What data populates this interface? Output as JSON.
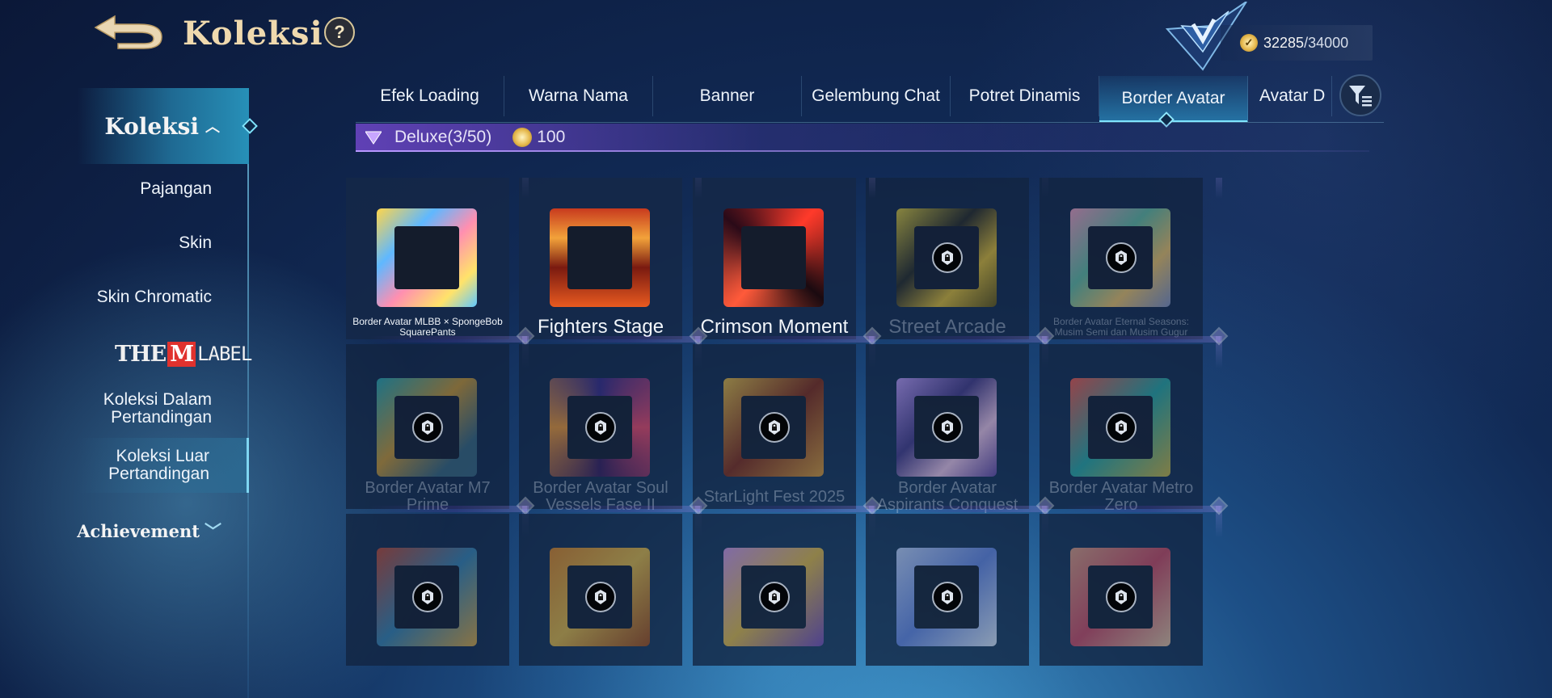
{
  "header": {
    "title": "Koleksi",
    "help_label": "?",
    "currency_current": "32285",
    "currency_max": "/34000"
  },
  "sidebar": {
    "koleksi_label": "Koleksi",
    "items": [
      "Pajangan",
      "Skin",
      "Skin Chromatic"
    ],
    "logo": {
      "the": "THE",
      "m": "M",
      "label": "LABEL"
    },
    "match_items": [
      {
        "line1": "Koleksi Dalam",
        "line2": "Pertandingan"
      },
      {
        "line1": "Koleksi Luar",
        "line2": "Pertandingan"
      }
    ],
    "achievement_label": "Achievement"
  },
  "tabs": [
    "Efek Loading",
    "Warna Nama",
    "Banner",
    "Gelembung Chat",
    "Potret Dinamis",
    "Border Avatar",
    "Avatar D"
  ],
  "active_tab": "Border Avatar",
  "deluxe": {
    "label": "Deluxe(3/50)",
    "price": "100"
  },
  "cards": [
    {
      "name": "Border Avatar MLBB × SpongeBob SquarePants",
      "locked": false
    },
    {
      "name": "Fighters Stage",
      "locked": false
    },
    {
      "name": "Crimson Moment",
      "locked": false
    },
    {
      "name": "Street Arcade",
      "locked": true
    },
    {
      "name": "Border Avatar Eternal Seasons: Musim Semi dan Musim Gugur",
      "locked": true
    },
    {
      "name": "Border Avatar M7 Prime",
      "locked": true
    },
    {
      "name": "Border Avatar Soul Vessels Fase II",
      "locked": true
    },
    {
      "name": "StarLight Fest 2025",
      "locked": true
    },
    {
      "name": "Border Avatar Aspirants Conquest",
      "locked": true
    },
    {
      "name": "Border Avatar Metro Zero",
      "locked": true
    },
    {
      "name": "",
      "locked": true
    },
    {
      "name": "",
      "locked": true
    },
    {
      "name": "",
      "locked": true
    },
    {
      "name": "",
      "locked": true
    },
    {
      "name": "",
      "locked": true
    }
  ],
  "colors": {
    "accent": "#7fe4ff",
    "title_gold": "#efd9ae",
    "deluxe_purple": "#6e46c8"
  }
}
